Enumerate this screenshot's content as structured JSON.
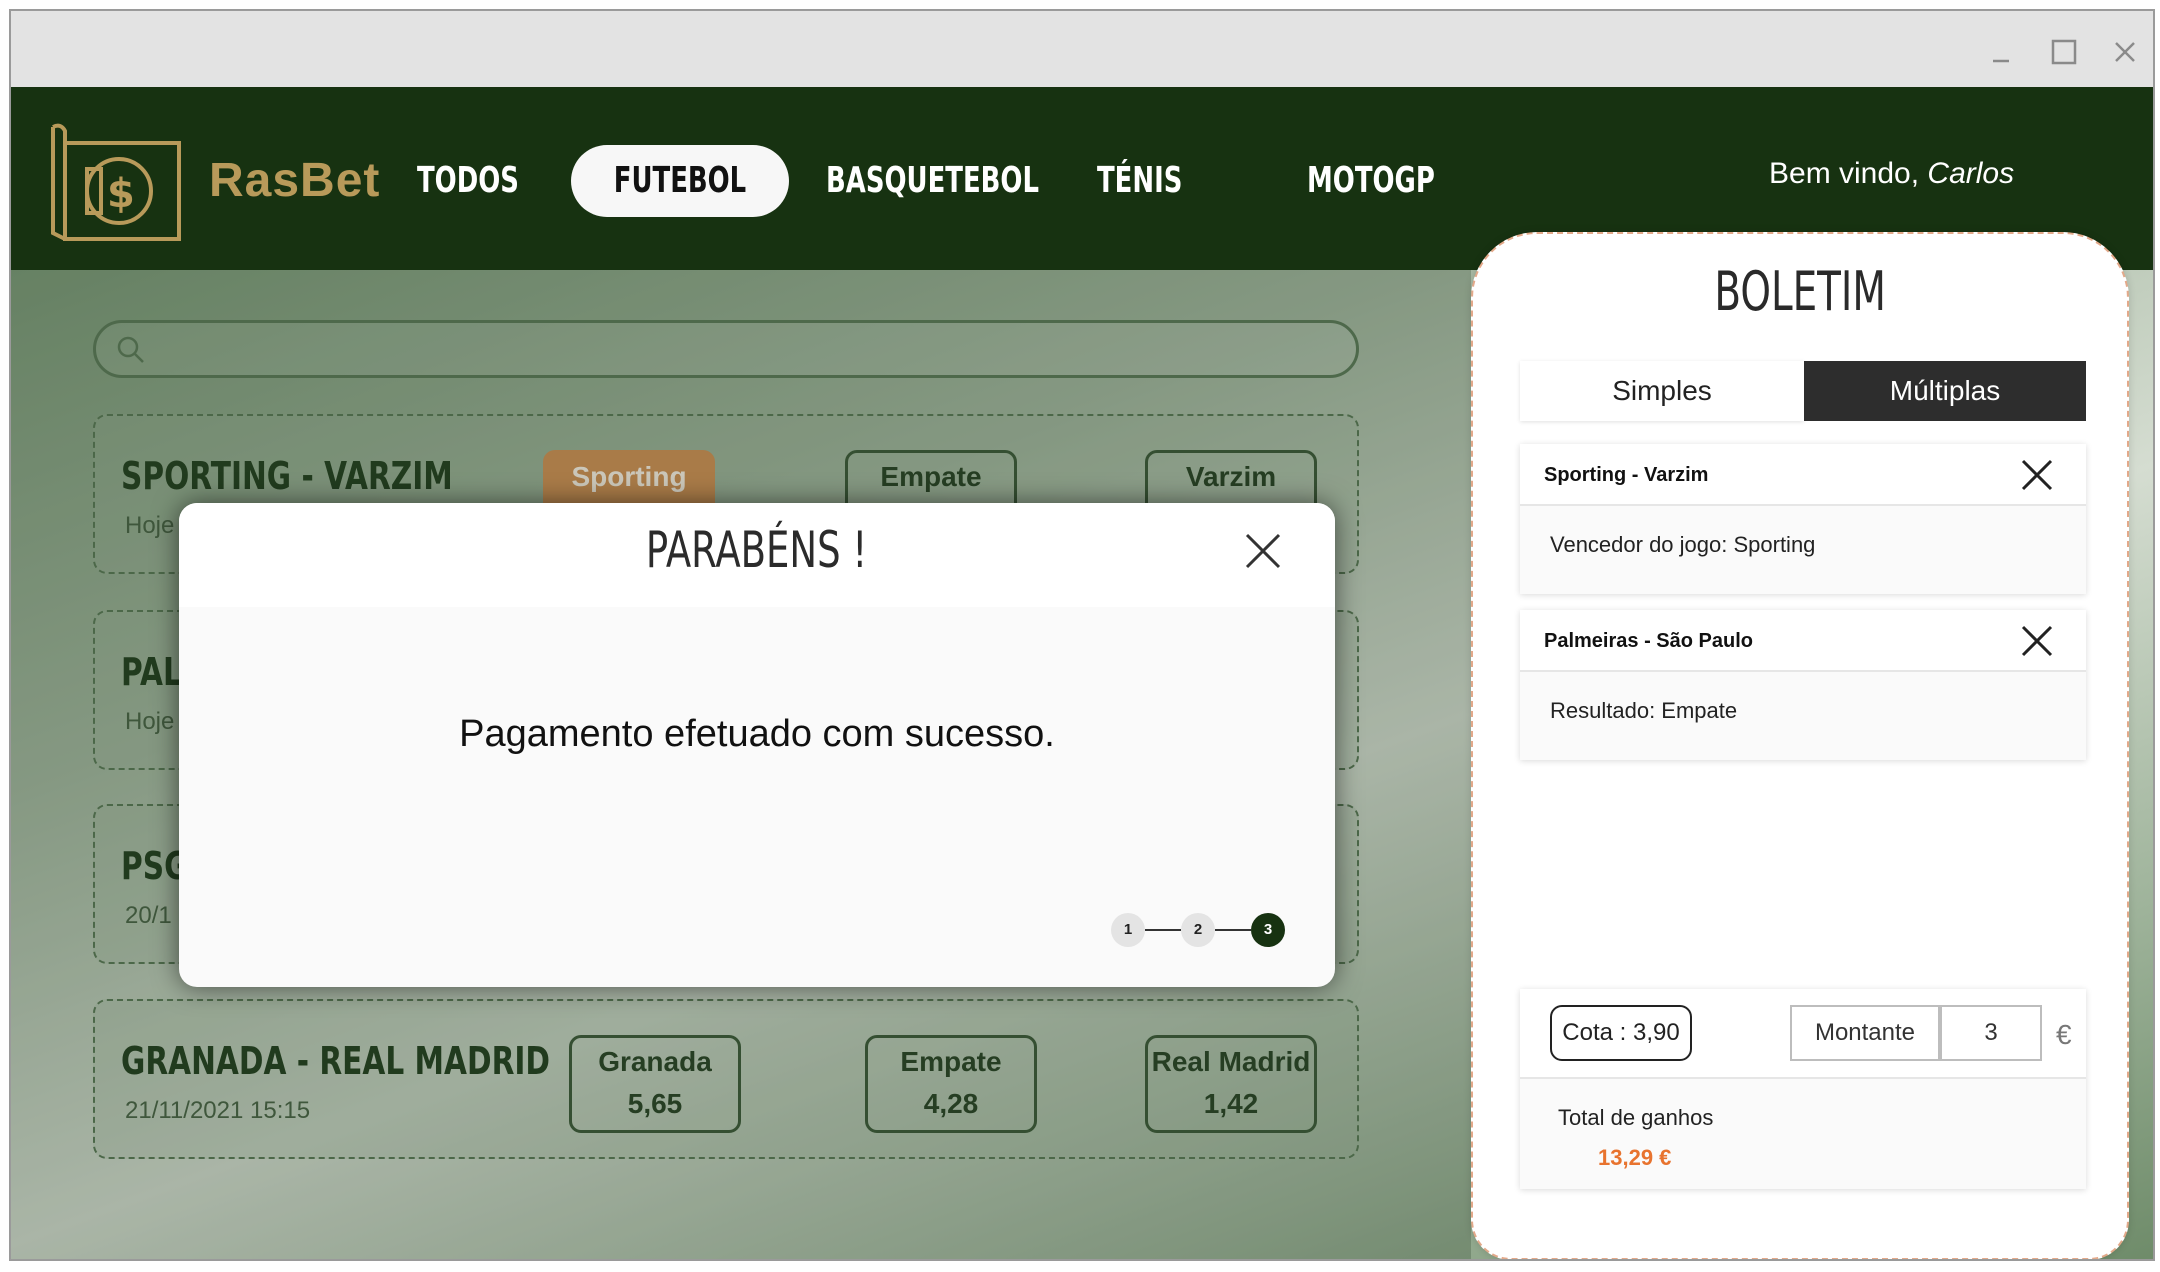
{
  "window": {
    "controls": [
      "minimize",
      "maximize",
      "close"
    ]
  },
  "brand": {
    "name": "RasBet",
    "logo_icon": "money-bill-icon",
    "gold": "#b89a5a"
  },
  "nav": {
    "items": [
      {
        "label": "TODOS",
        "active": false
      },
      {
        "label": "FUTEBOL",
        "active": true
      },
      {
        "label": "BASQUETEBOL",
        "active": false
      },
      {
        "label": "TÉNIS",
        "active": false
      },
      {
        "label": "MOTOGP",
        "active": false
      }
    ]
  },
  "welcome": {
    "prefix": "Bem vindo,",
    "user": "Carlos"
  },
  "search": {
    "placeholder": ""
  },
  "matches": [
    {
      "title": "SPORTING  -  VARZIM",
      "date": "Hoje",
      "odds": [
        {
          "label": "Sporting",
          "value": ""
        },
        {
          "label": "Empate",
          "value": ""
        },
        {
          "label": "Varzim",
          "value": ""
        }
      ]
    },
    {
      "title": "PALMEIRAS",
      "date": "Hoje",
      "odds": []
    },
    {
      "title": "PSG",
      "date": "20/1",
      "odds": []
    },
    {
      "title": "GRANADA  -  REAL MADRID",
      "date": "21/11/2021 15:15",
      "odds": [
        {
          "label": "Granada",
          "value": "5,65"
        },
        {
          "label": "Empate",
          "value": "4,28"
        },
        {
          "label": "Real Madrid",
          "value": "1,42"
        }
      ]
    }
  ],
  "modal": {
    "title": "PARABÉNS !",
    "message": "Pagamento efetuado com sucesso.",
    "steps": [
      "1",
      "2",
      "3"
    ],
    "current_step": 3
  },
  "boletim": {
    "title": "BOLETIM",
    "tabs": [
      {
        "label": "Simples",
        "active": false
      },
      {
        "label": "Múltiplas",
        "active": true
      }
    ],
    "bets": [
      {
        "game": "Sporting - Varzim",
        "description": "Vencedor do jogo: Sporting"
      },
      {
        "game": "Palmeiras - São Paulo",
        "description": "Resultado:  Empate"
      }
    ],
    "cota": "Cota : 3,90",
    "montante_label": "Montante",
    "montante_value": "3",
    "currency": "€",
    "total_label": "Total de ganhos",
    "total_value": "13,29 €"
  },
  "colors": {
    "header": "#173211",
    "accent_orange": "#e8732e",
    "selected_odd": "#d49258"
  }
}
